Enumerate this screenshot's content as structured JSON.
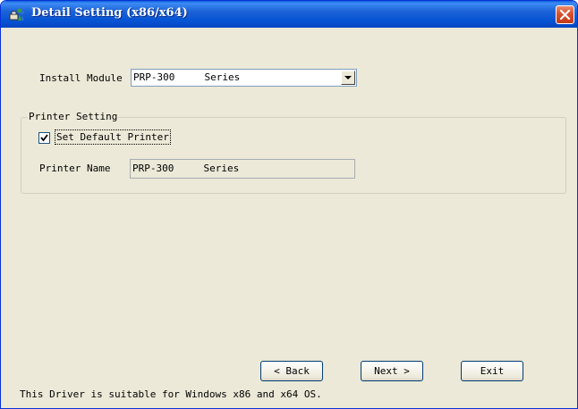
{
  "window": {
    "title": "Detail Setting (x86/x64)",
    "icon": "printer-people-icon",
    "close_icon": "close-icon",
    "colors": {
      "titlebar": "#0553d4",
      "close": "#d8502c",
      "face": "#ece9d8"
    }
  },
  "install_module": {
    "label": "Install Module",
    "selected": "PRP-300     Series"
  },
  "printer_setting": {
    "group_title": "Printer Setting",
    "set_default_label": "Set Default Printer",
    "set_default_checked": true,
    "printer_name_label": "Printer Name",
    "printer_name_value": "PRP-300     Series"
  },
  "buttons": {
    "back": "< Back",
    "next": "Next >",
    "exit": "Exit"
  },
  "footer": {
    "note": "This Driver is suitable for Windows x86 and x64 OS."
  }
}
